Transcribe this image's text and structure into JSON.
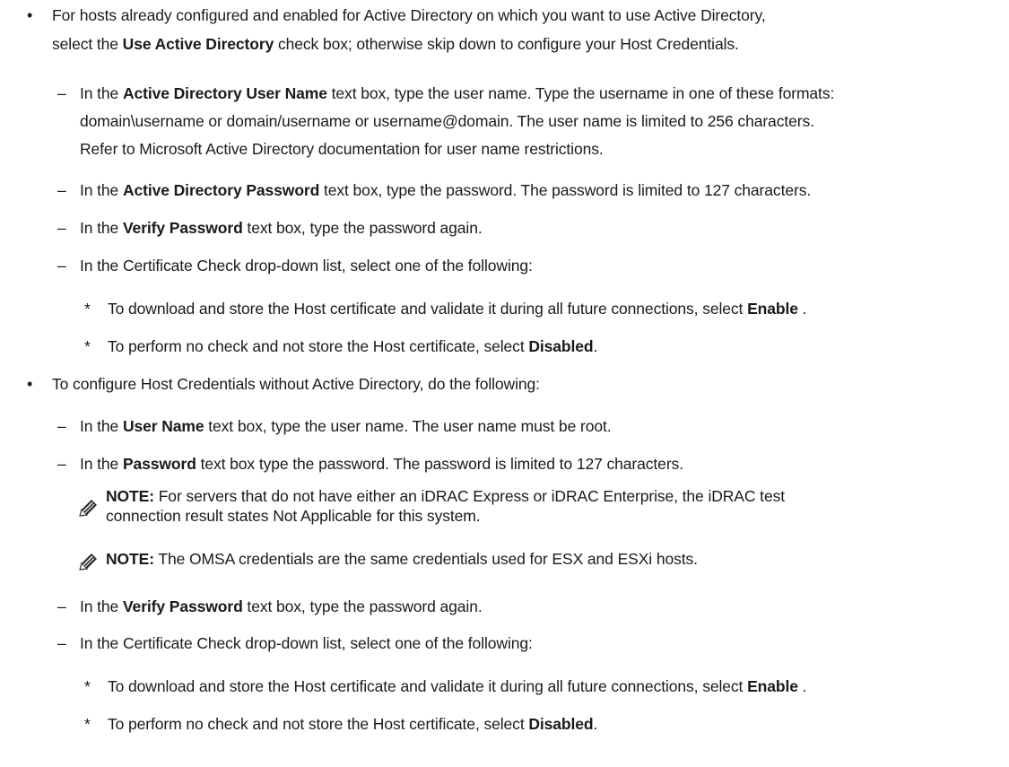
{
  "items": [
    {
      "l1_pre": "For hosts already configured and enabled for Active Directory on which you want to use Active Directory,",
      "l2_pre": "select the ",
      "l2_bold": "Use Active Directory",
      "l2_post": " check box; otherwise skip down to configure your Host Credentials."
    }
  ],
  "sub1": {
    "a_pre": "In the ",
    "a_bold": "Active Directory User Name",
    "a_post": " text box, type the user name. Type the username in one of these formats:",
    "a_l2": "domain\\username or domain/username or username@domain. The user name is limited to 256 characters.",
    "a_l3": "Refer to Microsoft Active Directory documentation for user name restrictions.",
    "b_pre": "In the ",
    "b_bold": "Active Directory Password",
    "b_post": " text box, type the password. The password is limited to 127 characters.",
    "c_pre": "In the ",
    "c_bold": "Verify Password",
    "c_post": " text box, type the password again.",
    "d_text": "In the Certificate Check drop-down list, select one of the following:",
    "e_pre": "To download and store the Host certificate and validate it during all future connections, select ",
    "e_bold": "Enable",
    "e_post": " .",
    "f_pre": "To perform no check and not store the Host certificate, select ",
    "f_bold": "Disabled",
    "f_post": "."
  },
  "item2": {
    "text": "To configure Host Credentials without Active Directory, do the following:"
  },
  "sub2": {
    "a_pre": "In the ",
    "a_bold": "User Name",
    "a_post": " text box, type the user name. The user name must be root.",
    "b_pre": "In the ",
    "b_bold": "Password",
    "b_post": " text box type the password. The password is limited to 127 characters.",
    "note1_label": "NOTE:",
    "note1_l1": " For servers that do not have either an iDRAC Express or iDRAC Enterprise, the iDRAC test",
    "note1_l2": "connection result states Not Applicable for this system.",
    "note2_label": "NOTE:",
    "note2_text": " The OMSA credentials are the same credentials used for ESX and ESXi hosts.",
    "c_pre": "In the ",
    "c_bold": "Verify Password",
    "c_post": " text box, type the password again.",
    "d_text": "In the Certificate Check drop-down list, select one of the following:",
    "e_pre": "To download and store the Host certificate and validate it during all future connections, select ",
    "e_bold": "Enable",
    "e_post": " .",
    "f_pre": "To perform no check and not store the Host certificate, select ",
    "f_bold": "Disabled",
    "f_post": "."
  },
  "markers": {
    "bullet": "•",
    "dash": "–",
    "star": "*"
  }
}
